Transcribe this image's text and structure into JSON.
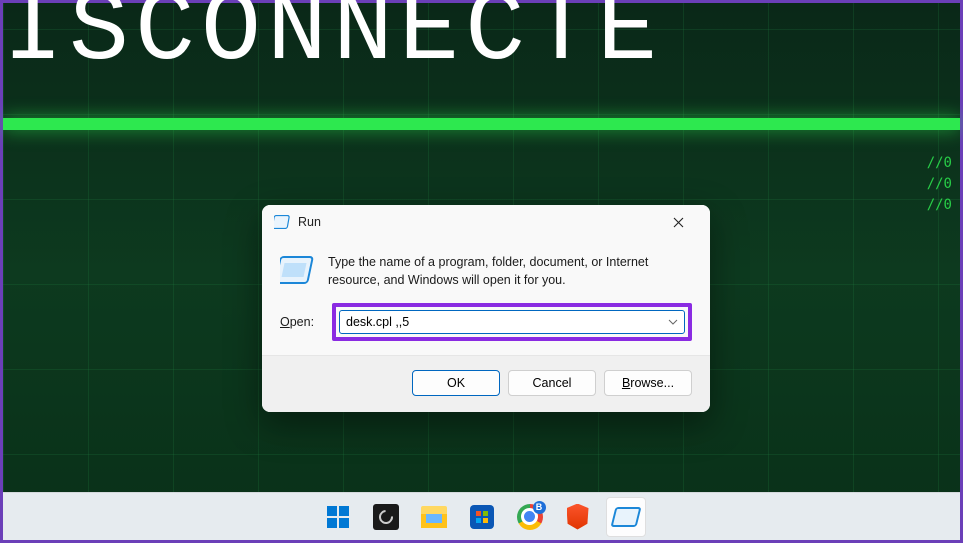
{
  "background": {
    "headline": "ISCONNECTE",
    "side_lines": [
      "//0",
      "//0",
      "//0"
    ]
  },
  "run_dialog": {
    "title": "Run",
    "description": "Type the name of a program, folder, document, or Internet resource, and Windows will open it for you.",
    "open_label_prefix": "O",
    "open_label_rest": "pen:",
    "input_value": "desk.cpl ,,5",
    "buttons": {
      "ok": "OK",
      "cancel": "Cancel",
      "browse_prefix": "B",
      "browse_rest": "rowse..."
    }
  },
  "taskbar": {
    "chrome_badge": "B"
  }
}
